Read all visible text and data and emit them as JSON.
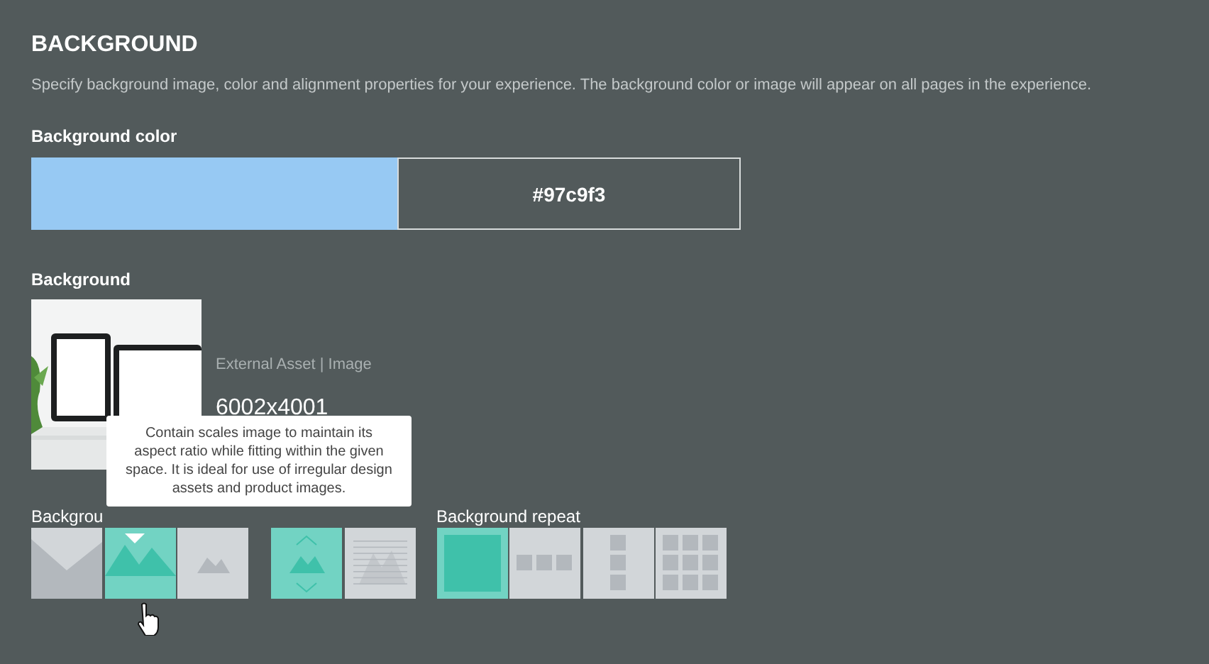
{
  "title": "BACKGROUND",
  "description": "Specify background image, color and alignment properties for your experience. The background color or image will appear on all pages in the experience.",
  "color_field": {
    "label": "Background color",
    "value": "#97c9f3"
  },
  "background": {
    "label": "Background",
    "asset_type": "External Asset | Image",
    "dimensions": "6002x4001"
  },
  "option_groups": [
    {
      "label": "Backgrou",
      "options": [
        {
          "kind": "cover",
          "selected": false
        },
        {
          "kind": "contain",
          "selected": true
        },
        {
          "kind": "center",
          "selected": false
        }
      ]
    },
    {
      "options": [
        {
          "kind": "scroll",
          "selected": true
        },
        {
          "kind": "fixed",
          "selected": false
        }
      ]
    },
    {
      "label": "Background repeat",
      "options": [
        {
          "kind": "no-repeat",
          "selected": true
        },
        {
          "kind": "repeat-x",
          "selected": false
        },
        {
          "kind": "repeat-y",
          "selected": false
        },
        {
          "kind": "repeat",
          "selected": false
        }
      ]
    }
  ],
  "tooltip": "Contain scales image to maintain its aspect ratio while fitting within the given space. It is ideal for use of irregular design assets and product images."
}
